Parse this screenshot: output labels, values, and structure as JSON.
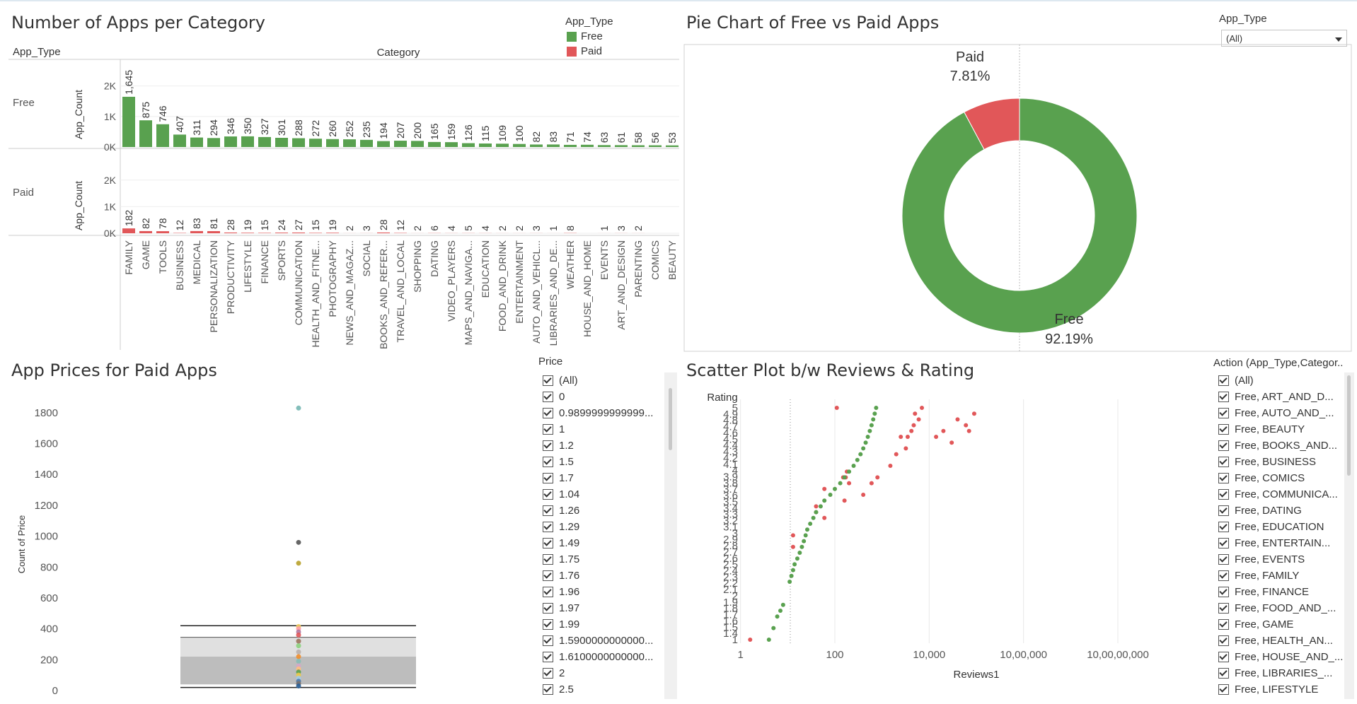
{
  "bar_panel": {
    "title": "Number of Apps per Category",
    "row_header": "App_Type",
    "col_header": "Category",
    "legend_title": "App_Type",
    "legend": [
      {
        "label": "Free",
        "color": "#59a14f"
      },
      {
        "label": "Paid",
        "color": "#e15759"
      }
    ]
  },
  "pie_panel": {
    "title": "Pie Chart of Free vs Paid Apps",
    "filter_title": "App_Type",
    "filter_value": "(All)",
    "dropdown_icon": "chevron-down-icon"
  },
  "box_panel": {
    "title": "App Prices for Paid Apps",
    "filter_title": "Price",
    "filter_items": [
      "(All)",
      "0",
      "0.9899999999999...",
      "1",
      "1.2",
      "1.5",
      "1.7",
      "1.04",
      "1.26",
      "1.29",
      "1.49",
      "1.75",
      "1.76",
      "1.96",
      "1.97",
      "1.99",
      "1.5900000000000...",
      "1.6100000000000...",
      "2",
      "2.5"
    ]
  },
  "scatter_panel": {
    "title": "Scatter Plot b/w Reviews & Rating",
    "filter_title": "Action (App_Type,Categor..",
    "filter_items": [
      "(All)",
      "Free, ART_AND_D...",
      "Free, AUTO_AND_...",
      "Free, BEAUTY",
      "Free, BOOKS_AND...",
      "Free, BUSINESS",
      "Free, COMICS",
      "Free, COMMUNICA...",
      "Free, DATING",
      "Free, EDUCATION",
      "Free, ENTERTAIN...",
      "Free, EVENTS",
      "Free, FAMILY",
      "Free, FINANCE",
      "Free, FOOD_AND_...",
      "Free, GAME",
      "Free, HEALTH_AN...",
      "Free, HOUSE_AND_...",
      "Free, LIBRARIES_...",
      "Free, LIFESTYLE"
    ]
  },
  "chart_data": [
    {
      "type": "bar",
      "title": "Number of Apps per Category",
      "xlabel": "Category",
      "ylabel": "App_Count",
      "ylim": [
        0,
        2500
      ],
      "yticks": [
        "0K",
        "1K",
        "2K"
      ],
      "categories": [
        "FAMILY",
        "GAME",
        "TOOLS",
        "BUSINESS",
        "MEDICAL",
        "PERSONALIZATION",
        "PRODUCTIVITY",
        "LIFESTYLE",
        "FINANCE",
        "SPORTS",
        "COMMUNICATION",
        "HEALTH_AND_FITNE...",
        "PHOTOGRAPHY",
        "NEWS_AND_MAGAZ...",
        "SOCIAL",
        "BOOKS_AND_REFER...",
        "TRAVEL_AND_LOCAL",
        "SHOPPING",
        "DATING",
        "VIDEO_PLAYERS",
        "MAPS_AND_NAVIGA...",
        "EDUCATION",
        "FOOD_AND_DRINK",
        "ENTERTAINMENT",
        "AUTO_AND_VEHICL...",
        "LIBRARIES_AND_DE...",
        "WEATHER",
        "HOUSE_AND_HOME",
        "EVENTS",
        "ART_AND_DESIGN",
        "PARENTING",
        "COMICS",
        "BEAUTY"
      ],
      "series": [
        {
          "name": "Free",
          "color": "#59a14f",
          "values": [
            1645,
            875,
            746,
            407,
            311,
            294,
            346,
            350,
            327,
            301,
            288,
            272,
            260,
            252,
            235,
            194,
            207,
            200,
            165,
            159,
            126,
            115,
            109,
            100,
            82,
            83,
            71,
            74,
            63,
            61,
            58,
            56,
            53
          ],
          "labels": [
            "1,645",
            "875",
            "746",
            "407",
            "311",
            "294",
            "346",
            "350",
            "327",
            "301",
            "288",
            "272",
            "260",
            "252",
            "235",
            "194",
            "207",
            "200",
            "165",
            "159",
            "126",
            "115",
            "109",
            "100",
            "82",
            "83",
            "71",
            "74",
            "63",
            "61",
            "58",
            "56",
            "53"
          ]
        },
        {
          "name": "Paid",
          "color": "#e15759",
          "values": [
            182,
            82,
            78,
            12,
            83,
            81,
            28,
            19,
            15,
            24,
            27,
            15,
            19,
            2,
            3,
            28,
            12,
            2,
            6,
            4,
            5,
            4,
            2,
            2,
            3,
            1,
            8,
            null,
            1,
            3,
            2,
            null,
            null
          ],
          "labels": [
            "182",
            "82",
            "78",
            "12",
            "83",
            "81",
            "28",
            "19",
            "15",
            "24",
            "27",
            "15",
            "19",
            "2",
            "3",
            "28",
            "12",
            "2",
            "6",
            "4",
            "5",
            "4",
            "2",
            "2",
            "3",
            "1",
            "8",
            "",
            "1",
            "3",
            "2",
            "",
            ""
          ]
        }
      ]
    },
    {
      "type": "pie",
      "title": "Pie Chart of Free vs Paid Apps",
      "slices": [
        {
          "name": "Free",
          "value": 92.19,
          "label": "92.19%",
          "color": "#59a14f"
        },
        {
          "name": "Paid",
          "value": 7.81,
          "label": "7.81%",
          "color": "#e15759"
        }
      ]
    },
    {
      "type": "scatter",
      "title": "App Prices for Paid Apps",
      "ylabel": "Count of Price",
      "ylim": [
        0,
        1900
      ],
      "yticks": [
        0,
        200,
        400,
        600,
        800,
        1000,
        1200,
        1400,
        1600,
        1800
      ],
      "box": {
        "whisker_low": 20,
        "q1": 40,
        "median": 220,
        "q3": 345,
        "whisker_high": 420
      },
      "points": [
        {
          "y": 1830,
          "color": "#76b7b2"
        },
        {
          "y": 960,
          "color": "#555555"
        },
        {
          "y": 825,
          "color": "#b8a12a"
        },
        {
          "y": 415,
          "color": "#f1ce63"
        },
        {
          "y": 400,
          "color": "#ff9da7"
        },
        {
          "y": 380,
          "color": "#b07aa1"
        },
        {
          "y": 360,
          "color": "#e15759"
        },
        {
          "y": 320,
          "color": "#9c755f"
        },
        {
          "y": 290,
          "color": "#8cd17d"
        },
        {
          "y": 250,
          "color": "#bab0ac"
        },
        {
          "y": 220,
          "color": "#f28e2b"
        },
        {
          "y": 190,
          "color": "#86bcb6"
        },
        {
          "y": 160,
          "color": "#d4a6c8"
        },
        {
          "y": 140,
          "color": "#ffbe7d"
        },
        {
          "y": 120,
          "color": "#59a14f"
        },
        {
          "y": 100,
          "color": "#edc948"
        },
        {
          "y": 80,
          "color": "#a0cbe8"
        },
        {
          "y": 60,
          "color": "#4e79a7"
        },
        {
          "y": 45,
          "color": "#79706e"
        },
        {
          "y": 30,
          "color": "#2a6099"
        }
      ]
    },
    {
      "type": "scatter",
      "title": "Scatter Plot b/w Reviews & Rating",
      "xlabel": "Reviews1",
      "ylabel": "Rating",
      "xscale": "log",
      "xticks": [
        "1",
        "100",
        "10,000",
        "10,00,000",
        "10,00,00,000"
      ],
      "ytick_labels": [
        "1",
        "1.4",
        "1.5",
        "1.6",
        "1.7",
        "1.8",
        "1.9",
        "2",
        "2.1",
        "2.2",
        "2.3",
        "2.4",
        "2.5",
        "2.6",
        "2.7",
        "2.8",
        "2.9",
        "3",
        "3.1",
        "3.2",
        "3.3",
        "3.4",
        "3.5",
        "3.6",
        "3.7",
        "3.8",
        "3.9",
        "4",
        "4.1",
        "4.2",
        "4.3",
        "4.4",
        "4.5",
        "4.6",
        "4.7",
        "4.8",
        "4.9",
        "5"
      ],
      "series": [
        {
          "name": "Paid",
          "color": "#e15759",
          "points": [
            [
              1.6,
              1
            ],
            [
              13,
              2.6
            ],
            [
              13,
              2.8
            ],
            [
              40,
              3.2
            ],
            [
              60,
              3.1
            ],
            [
              40,
              3.3
            ],
            [
              60,
              3.6
            ],
            [
              110,
              5
            ],
            [
              160,
              3.4
            ],
            [
              150,
              3.8
            ],
            [
              170,
              3.8
            ],
            [
              180,
              3.9
            ],
            [
              200,
              3.7
            ],
            [
              400,
              3.5
            ],
            [
              600,
              3.7
            ],
            [
              800,
              3.8
            ],
            [
              1500,
              4
            ],
            [
              2000,
              4.2
            ],
            [
              2500,
              4.5
            ],
            [
              3200,
              4.3
            ],
            [
              3500,
              4.5
            ],
            [
              4200,
              4.6
            ],
            [
              4700,
              4.7
            ],
            [
              5000,
              4.9
            ],
            [
              6000,
              4.8
            ],
            [
              7000,
              5
            ],
            [
              14000,
              4.5
            ],
            [
              20000,
              4.6
            ],
            [
              30000,
              4.4
            ],
            [
              40000,
              4.8
            ],
            [
              60000,
              4.7
            ],
            [
              70000,
              4.6
            ],
            [
              90000,
              4.9
            ]
          ]
        },
        {
          "name": "Free",
          "color": "#59a14f",
          "points": [
            [
              4,
              1
            ],
            [
              5,
              1.2
            ],
            [
              6,
              1.4
            ],
            [
              7,
              1.5
            ],
            [
              8,
              1.6
            ],
            [
              11,
              2
            ],
            [
              12,
              2.1
            ],
            [
              13,
              2.2
            ],
            [
              14,
              2.3
            ],
            [
              16,
              2.4
            ],
            [
              18,
              2.5
            ],
            [
              20,
              2.6
            ],
            [
              22,
              2.7
            ],
            [
              24,
              2.8
            ],
            [
              26,
              2.9
            ],
            [
              30,
              3
            ],
            [
              35,
              3.1
            ],
            [
              40,
              3.2
            ],
            [
              50,
              3.3
            ],
            [
              60,
              3.4
            ],
            [
              80,
              3.5
            ],
            [
              100,
              3.6
            ],
            [
              130,
              3.7
            ],
            [
              160,
              3.8
            ],
            [
              200,
              3.9
            ],
            [
              250,
              4
            ],
            [
              300,
              4.1
            ],
            [
              350,
              4.2
            ],
            [
              400,
              4.3
            ],
            [
              450,
              4.4
            ],
            [
              500,
              4.5
            ],
            [
              550,
              4.6
            ],
            [
              600,
              4.7
            ],
            [
              650,
              4.8
            ],
            [
              700,
              4.9
            ],
            [
              750,
              5
            ]
          ]
        }
      ]
    }
  ]
}
